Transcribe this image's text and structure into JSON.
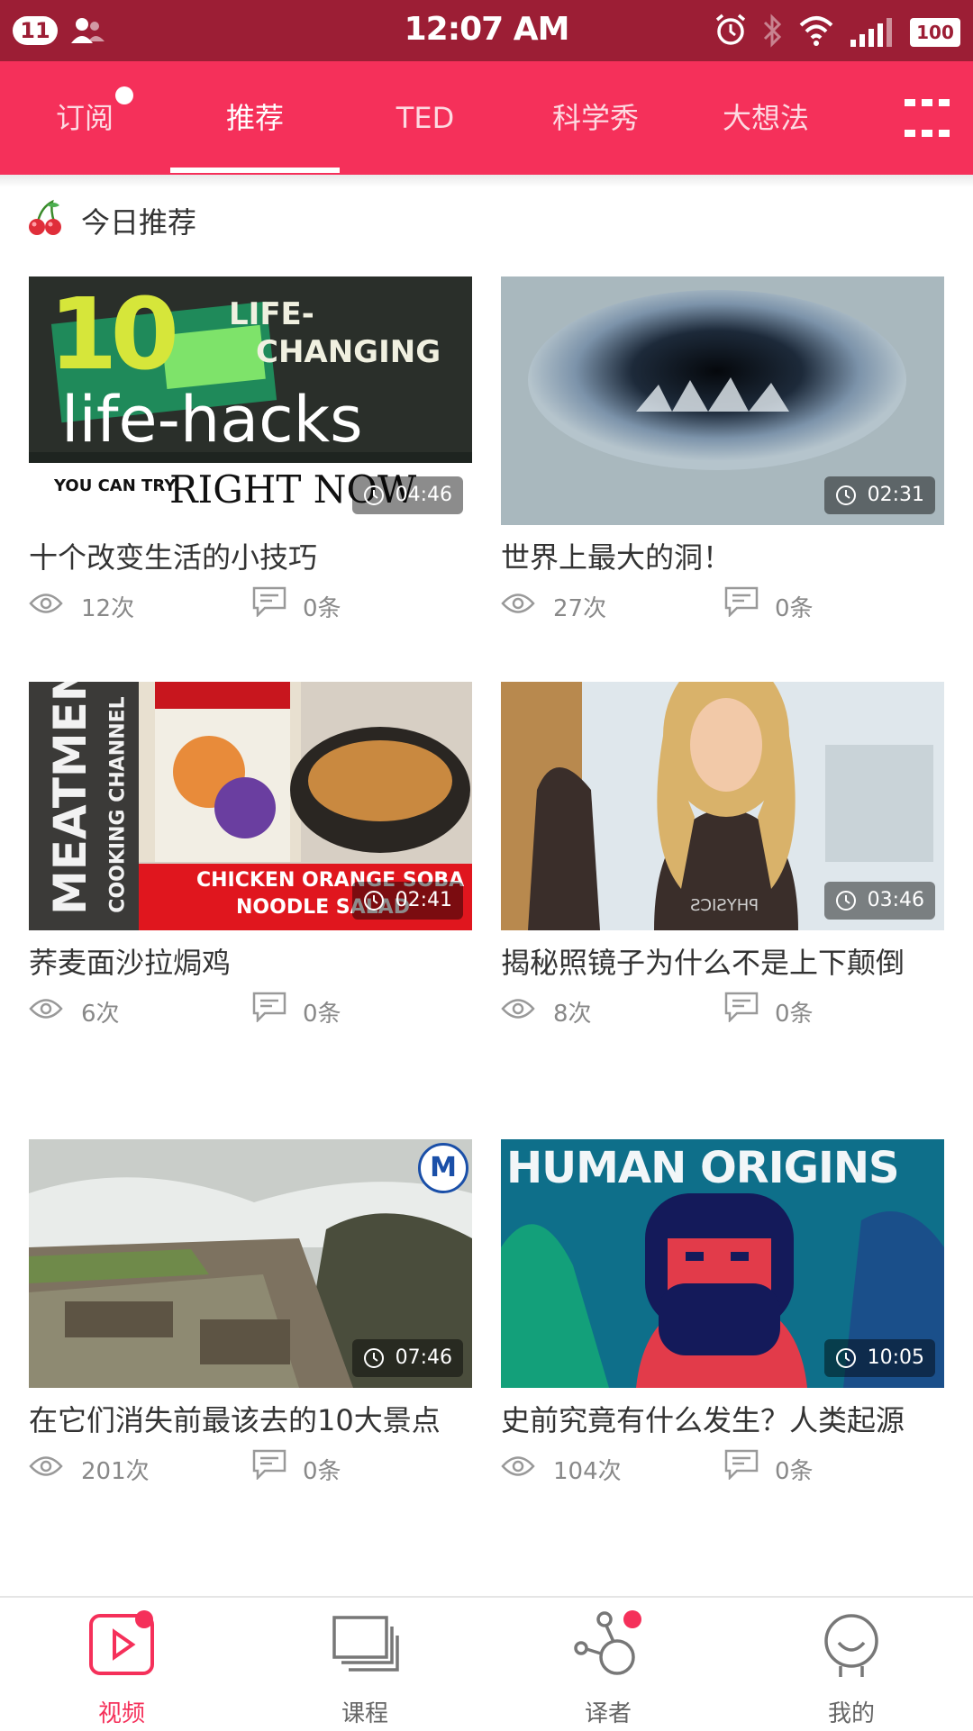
{
  "status_bar": {
    "notification_count": "11",
    "time": "12:07 AM",
    "battery": "100",
    "icons": [
      "user-icon",
      "alarm-icon",
      "bluetooth-icon",
      "wifi-icon",
      "signal-icon",
      "battery-icon"
    ]
  },
  "tabs": [
    {
      "label": "订阅",
      "badge": true
    },
    {
      "label": "推荐",
      "active": true
    },
    {
      "label": "TED"
    },
    {
      "label": "科学秀"
    },
    {
      "label": "大想法"
    }
  ],
  "section": {
    "title": "今日推荐",
    "icon": "cherry-icon"
  },
  "videos": [
    {
      "title": "十个改变生活的小技巧",
      "views": "12次",
      "comments": "0条",
      "duration": "04:46",
      "thumb_text": {
        "big": "10",
        "line1": "LIFE-",
        "line2": "CHANGING",
        "line3": "life-hacks",
        "line4": "YOU CAN TRY",
        "line5": "RIGHT NOW"
      }
    },
    {
      "title": "世界上最大的洞！",
      "views": "27次",
      "comments": "0条",
      "duration": "02:31"
    },
    {
      "title": "荞麦面沙拉焗鸡",
      "views": "6次",
      "comments": "0条",
      "duration": "02:41",
      "thumb_text": {
        "side1": "MEATMEN",
        "side2": "COOKING CHANNEL",
        "banner1": "CHICKEN ORANGE SOBA",
        "banner2": "NOODLE SALAD"
      }
    },
    {
      "title": "揭秘照镜子为什么不是上下颠倒",
      "views": "8次",
      "comments": "0条",
      "duration": "03:46",
      "thumb_text": {
        "shirt": "PHYSICS"
      }
    },
    {
      "title": "在它们消失前最该去的10大景点",
      "views": "201次",
      "comments": "0条",
      "duration": "07:46",
      "thumb_text": {
        "badge": "M"
      }
    },
    {
      "title": "史前究竟有什么发生？人类起源",
      "views": "104次",
      "comments": "0条",
      "duration": "10:05",
      "thumb_text": {
        "heading": "HUMAN ORIGINS"
      }
    }
  ],
  "bottom_nav": [
    {
      "label": "视频",
      "icon": "video-play-icon",
      "active": true,
      "badge": true
    },
    {
      "label": "课程",
      "icon": "courses-stack-icon"
    },
    {
      "label": "译者",
      "icon": "translator-network-icon",
      "badge": true
    },
    {
      "label": "我的",
      "icon": "profile-face-icon"
    }
  ],
  "colors": {
    "status_bar": "#9c1e35",
    "accent": "#f5305a",
    "text": "#333333",
    "meta": "#888888"
  }
}
